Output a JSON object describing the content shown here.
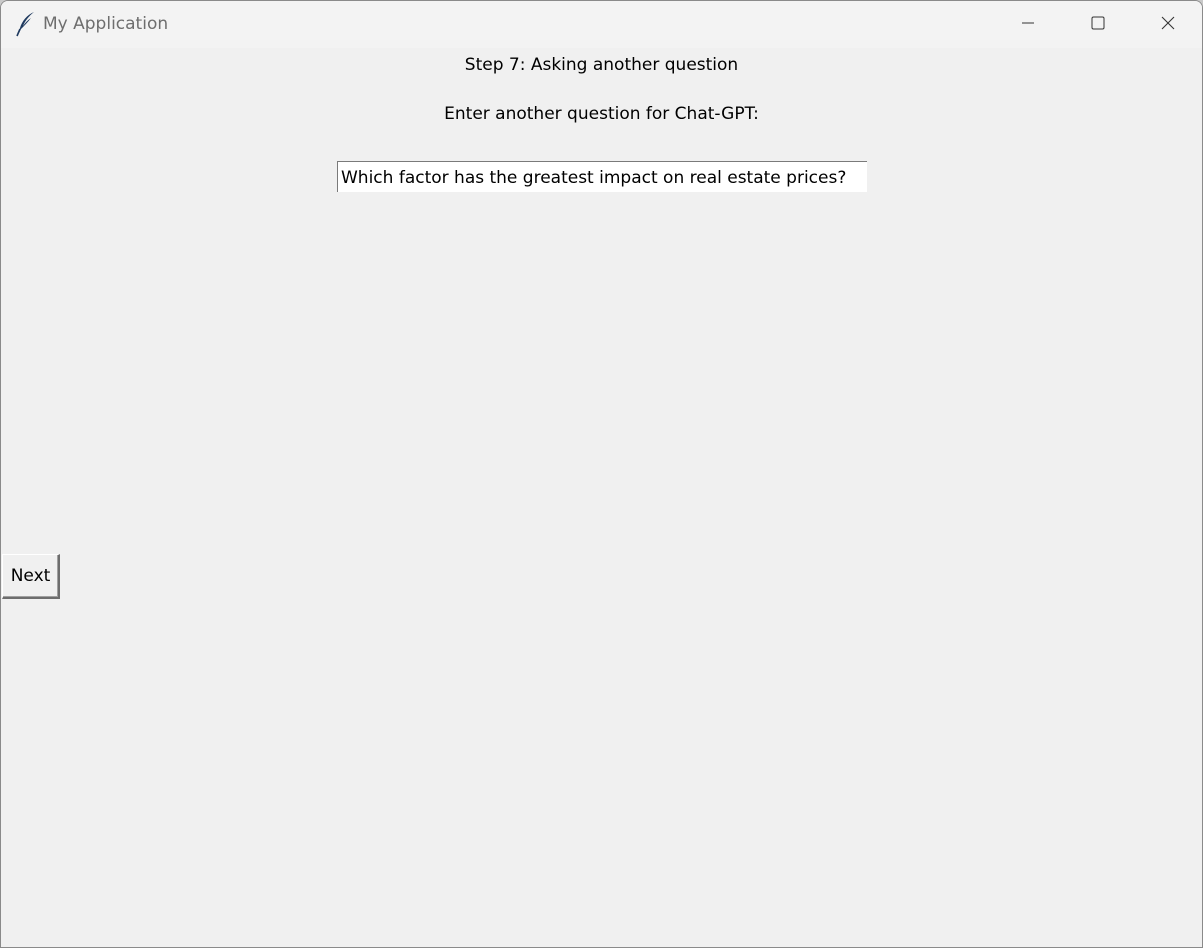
{
  "window": {
    "title": "My Application",
    "icon": "feather-icon",
    "controls": {
      "minimize_icon": "minimize-icon",
      "maximize_icon": "maximize-icon",
      "close_icon": "close-icon"
    }
  },
  "main": {
    "step_label": "Step 7: Asking another question",
    "prompt_label": "Enter another question for Chat-GPT:",
    "question_value": "Which factor has the greatest impact on real estate prices?",
    "next_label": "Next"
  },
  "colors": {
    "background": "#f0f0f0",
    "titlebar": "#f3f3f3",
    "title_text": "#6e6e6e"
  }
}
